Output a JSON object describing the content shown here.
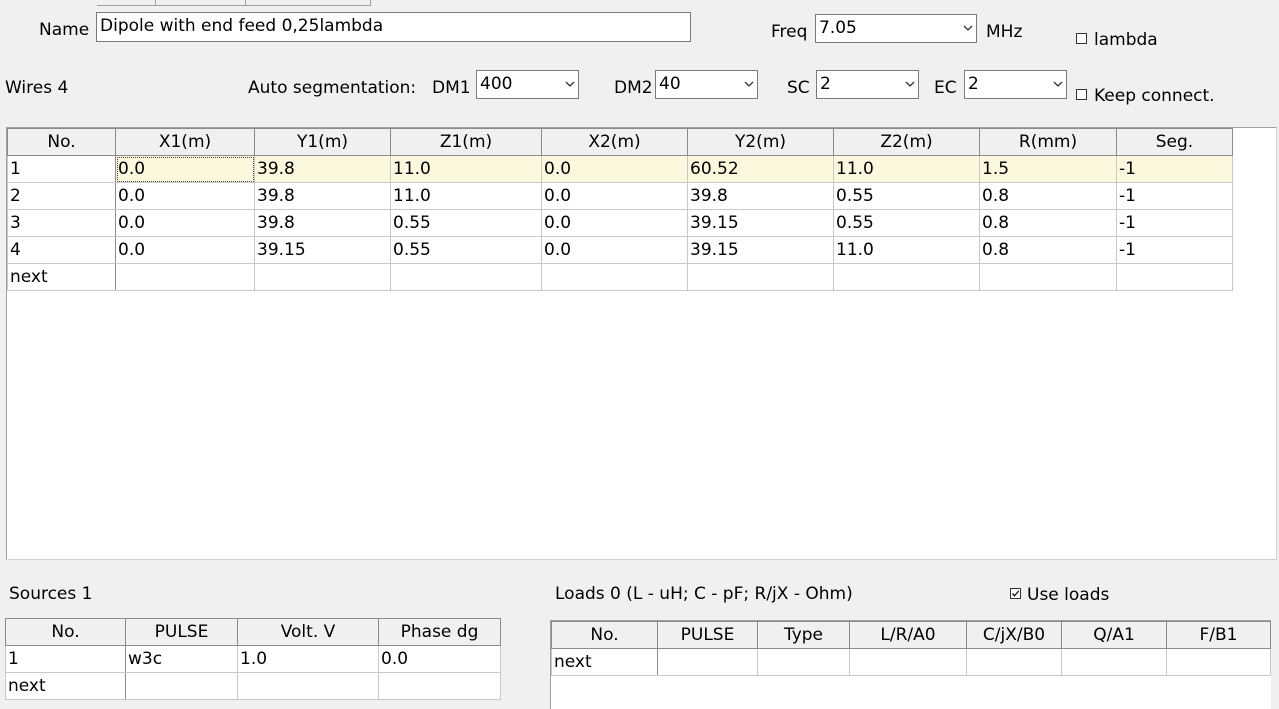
{
  "form": {
    "name_label": "Name",
    "name_value": "Dipole with end feed 0,25lambda",
    "freq_label": "Freq",
    "freq_value": "7.05",
    "freq_unit": "MHz",
    "lambda_label": "lambda",
    "lambda_checked": false
  },
  "wires": {
    "count_label": "Wires 4",
    "auto_seg_label": "Auto segmentation:",
    "dm1_label": "DM1",
    "dm1_value": "400",
    "dm2_label": "DM2",
    "dm2_value": "40",
    "sc_label": "SC",
    "sc_value": "2",
    "ec_label": "EC",
    "ec_value": "2",
    "keep_connect_label": "Keep connect.",
    "keep_connect_checked": false,
    "columns": [
      "No.",
      "X1(m)",
      "Y1(m)",
      "Z1(m)",
      "X2(m)",
      "Y2(m)",
      "Z2(m)",
      "R(mm)",
      "Seg."
    ],
    "rows": [
      [
        "1",
        "0.0",
        "39.8",
        "11.0",
        "0.0",
        "60.52",
        "11.0",
        "1.5",
        "-1"
      ],
      [
        "2",
        "0.0",
        "39.8",
        "11.0",
        "0.0",
        "39.8",
        "0.55",
        "0.8",
        "-1"
      ],
      [
        "3",
        "0.0",
        "39.8",
        "0.55",
        "0.0",
        "39.15",
        "0.55",
        "0.8",
        "-1"
      ],
      [
        "4",
        "0.0",
        "39.15",
        "0.55",
        "0.0",
        "39.15",
        "11.0",
        "0.8",
        "-1"
      ]
    ],
    "next_label": "next"
  },
  "sources": {
    "count_label": "Sources 1",
    "columns": [
      "No.",
      "PULSE",
      "Volt. V",
      "Phase dg"
    ],
    "rows": [
      [
        "1",
        "w3c",
        "1.0",
        "0.0"
      ]
    ],
    "next_label": "next"
  },
  "loads": {
    "count_label": "Loads 0 (L - uH; C - pF; R/jX - Ohm)",
    "use_loads_label": "Use loads",
    "use_loads_checked": true,
    "columns": [
      "No.",
      "PULSE",
      "Type",
      "L/R/A0",
      "C/jX/B0",
      "Q/A1",
      "F/B1"
    ],
    "next_label": "next"
  },
  "colors": {
    "selected_row": "#fbf8dd",
    "background": "#f0f0f0",
    "grid_line": "#c8c8c8"
  }
}
